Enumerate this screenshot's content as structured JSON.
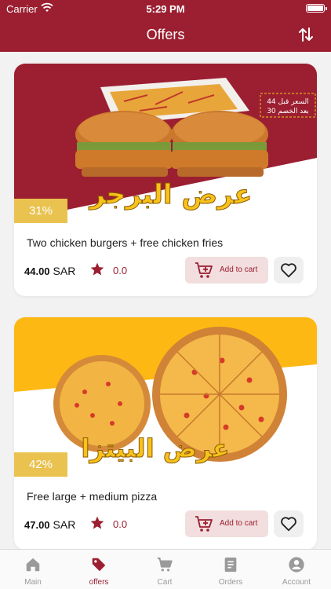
{
  "status_bar": {
    "carrier": "Carrier",
    "time": "5:29 PM"
  },
  "nav": {
    "title": "Offers"
  },
  "offers": [
    {
      "banner_text": "عرض البرجر",
      "price_note_line1": "السعر قبل 44",
      "price_note_line2": "بعد الخصم 30",
      "discount": "31%",
      "title": "Two chicken burgers + free chicken fries",
      "price": "44.00",
      "currency": "SAR",
      "rating": "0.0",
      "add_to_cart": "Add to cart"
    },
    {
      "banner_text": "عرض البيتزا",
      "discount": "42%",
      "title": "Free large + medium pizza",
      "price": "47.00",
      "currency": "SAR",
      "rating": "0.0",
      "add_to_cart": "Add to cart"
    }
  ],
  "tabs": [
    {
      "label": "Main",
      "icon": "home-icon"
    },
    {
      "label": "offers",
      "icon": "tag-icon",
      "active": true
    },
    {
      "label": "Cart",
      "icon": "cart-icon"
    },
    {
      "label": "Orders",
      "icon": "orders-icon"
    },
    {
      "label": "Account",
      "icon": "account-icon"
    }
  ],
  "colors": {
    "primary": "#9b1f31",
    "discount_badge": "#e9c24f",
    "pizza_banner": "#fdb813",
    "tab_inactive": "#999999"
  }
}
